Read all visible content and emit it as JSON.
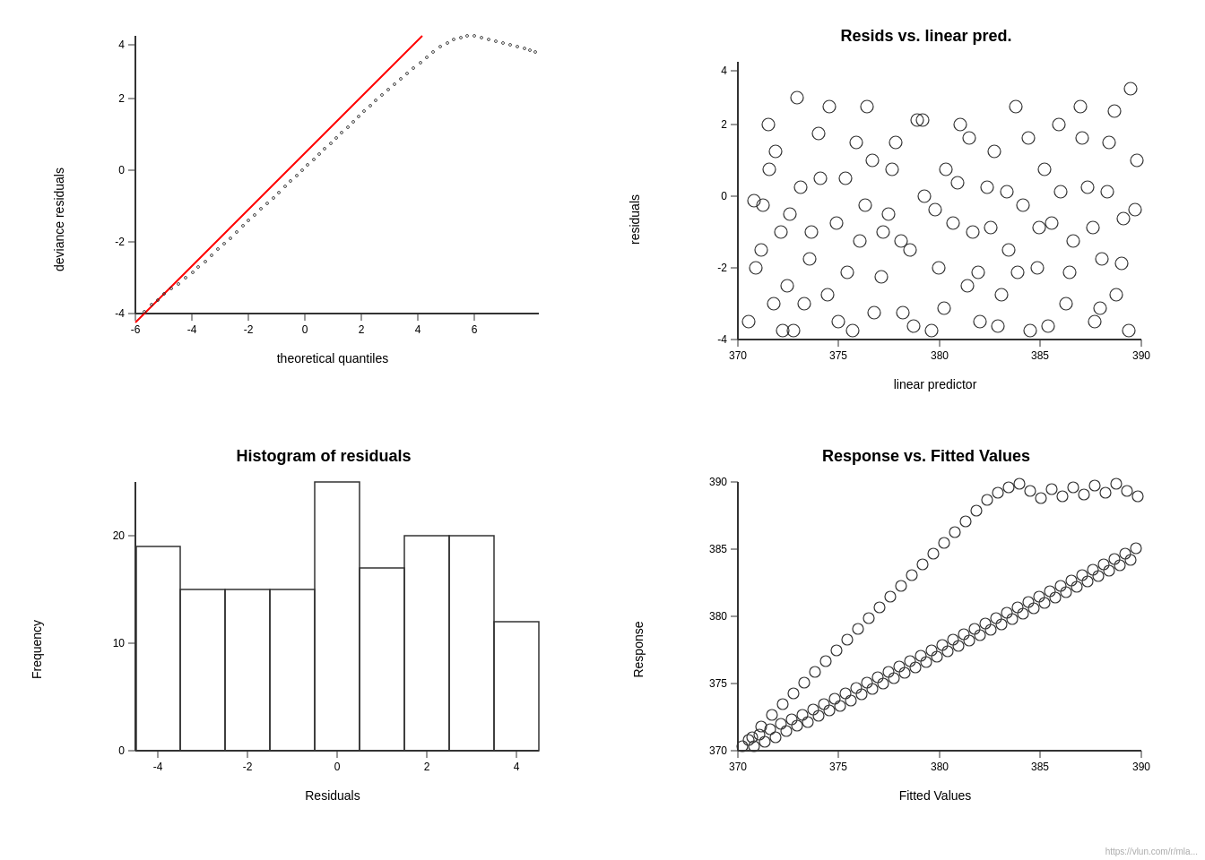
{
  "panels": {
    "qqplot": {
      "title": "",
      "y_label": "deviance residuals",
      "x_label": "theoretical quantiles",
      "x_ticks": [
        "-6",
        "-4",
        "-2",
        "0",
        "2",
        "4",
        "6"
      ],
      "y_ticks": [
        "-4",
        "-2",
        "0",
        "2",
        "4"
      ]
    },
    "resids_vs_linear": {
      "title": "Resids vs. linear pred.",
      "y_label": "residuals",
      "x_label": "linear predictor",
      "x_ticks": [
        "370",
        "375",
        "380",
        "385",
        "390"
      ],
      "y_ticks": [
        "-4",
        "-2",
        "0",
        "2",
        "4"
      ]
    },
    "histogram": {
      "title": "Histogram of residuals",
      "y_label": "Frequency",
      "x_label": "Residuals",
      "x_ticks": [
        "-4",
        "-2",
        "0",
        "2",
        "4"
      ],
      "y_ticks": [
        "0",
        "10",
        "20"
      ],
      "bars": [
        {
          "x": -4.5,
          "w": 1,
          "h": 19
        },
        {
          "x": -3.5,
          "w": 1,
          "h": 15
        },
        {
          "x": -2.5,
          "w": 1,
          "h": 15
        },
        {
          "x": -1.5,
          "w": 1,
          "h": 15
        },
        {
          "x": -0.5,
          "w": 1,
          "h": 25
        },
        {
          "x": 0.5,
          "w": 1,
          "h": 17
        },
        {
          "x": 1.5,
          "w": 1,
          "h": 20
        },
        {
          "x": 2.5,
          "w": 1,
          "h": 20
        },
        {
          "x": 3.5,
          "w": 1,
          "h": 12
        }
      ]
    },
    "response_vs_fitted": {
      "title": "Response vs. Fitted Values",
      "y_label": "Response",
      "x_label": "Fitted Values",
      "x_ticks": [
        "370",
        "375",
        "380",
        "385",
        "390"
      ],
      "y_ticks": [
        "370",
        "375",
        "380",
        "385",
        "390"
      ]
    }
  },
  "watermark": "https://vlun.com/r/mla..."
}
